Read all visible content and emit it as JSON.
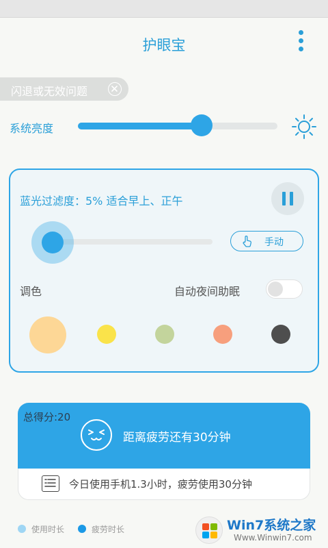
{
  "header": {
    "title": "护眼宝"
  },
  "notice": {
    "label": "闪退或无效问题"
  },
  "brightness": {
    "label": "系统亮度",
    "level_percent": 62
  },
  "filter": {
    "status_text": "蓝光过滤度：5% 适合早上、正午",
    "level_percent": 5,
    "mode_label": "手动",
    "tint_label": "调色",
    "night_label": "自动夜间助眠",
    "night_enabled": false,
    "swatch_colors": [
      "#fdd796",
      "#fae34a",
      "#c3d49c",
      "#f79f7d",
      "#4e4e4e"
    ]
  },
  "score": {
    "label": "总得分:20",
    "fatigue_text": "距离疲劳还有30分钟",
    "usage_text": "今日使用手机1.3小时，疲劳使用30分钟"
  },
  "legend": {
    "items": [
      {
        "label": "使用时长",
        "color": "#9fd6f4"
      },
      {
        "label": "疲劳时长",
        "color": "#1b99e6"
      }
    ]
  },
  "watermark": {
    "title": "Win7系统之家",
    "url": "Www.Winwin7.com"
  },
  "colors": {
    "accent": "#2ea5e6",
    "text_accent": "#2a9fd8"
  },
  "icons": {
    "menu": "more-vertical-icon",
    "notice_close": "close-circle-icon",
    "brightness": "sun-icon",
    "pause": "pause-icon",
    "manual": "hand-pointer-icon",
    "fatigue": "tired-face-icon",
    "usage": "document-icon"
  }
}
